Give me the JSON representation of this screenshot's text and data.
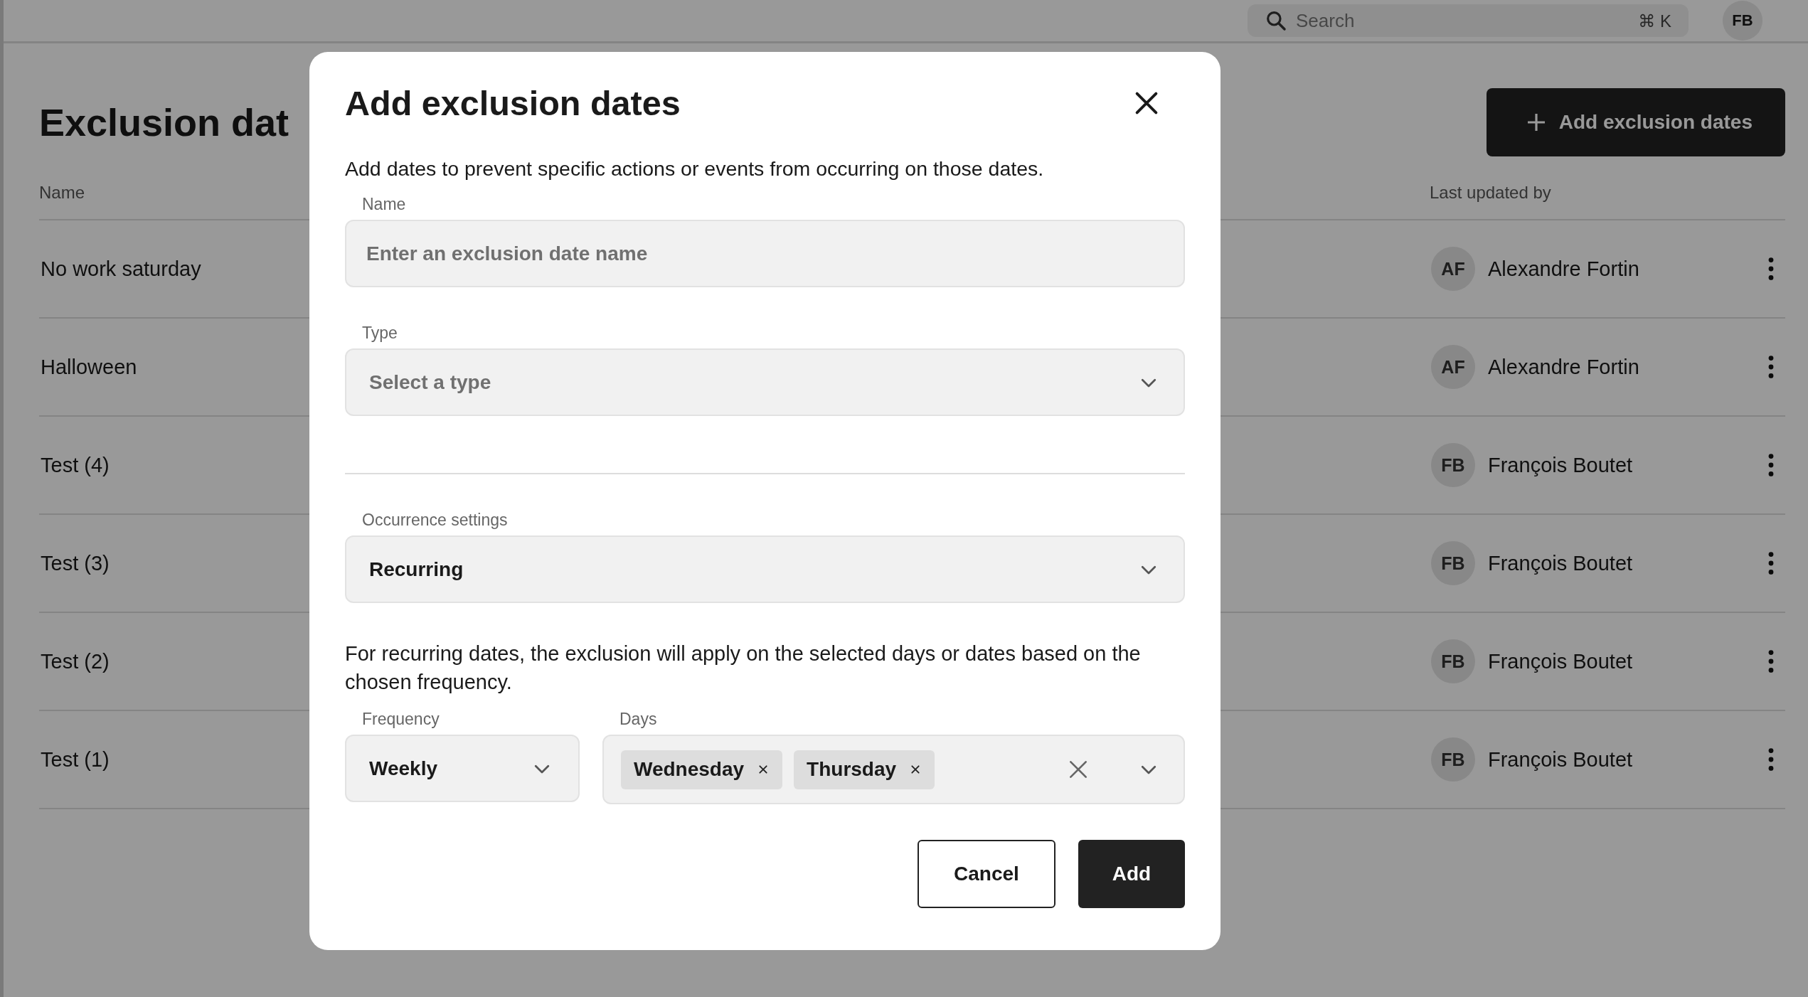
{
  "top_bar": {
    "search": {
      "placeholder": "Search",
      "shortcut": "⌘ K"
    },
    "avatar": "FB"
  },
  "page": {
    "title": "Exclusion dat",
    "add_button": "Add exclusion dates"
  },
  "table": {
    "columns": [
      "Name",
      "Last updated by"
    ],
    "rows": [
      {
        "name": "No work saturday",
        "initials": "AF",
        "user": "Alexandre Fortin"
      },
      {
        "name": "Halloween",
        "initials": "AF",
        "user": "Alexandre Fortin"
      },
      {
        "name": "Test (4)",
        "initials": "FB",
        "user": "François Boutet"
      },
      {
        "name": "Test (3)",
        "initials": "FB",
        "user": "François Boutet"
      },
      {
        "name": "Test (2)",
        "initials": "FB",
        "user": "François Boutet"
      },
      {
        "name": "Test (1)",
        "initials": "FB",
        "user": "François Boutet"
      }
    ]
  },
  "dialog": {
    "title": "Add exclusion dates",
    "description": "Add dates to prevent specific actions or events from occurring on those dates.",
    "name_field": {
      "label": "Name",
      "placeholder": "Enter an exclusion date name"
    },
    "type_field": {
      "label": "Type",
      "placeholder": "Select a type"
    },
    "occurrence_field": {
      "label": "Occurrence settings",
      "value": "Recurring"
    },
    "recurring_note": "For recurring dates, the exclusion will apply on the selected days or dates based on the chosen frequency.",
    "frequency_field": {
      "label": "Frequency",
      "value": "Weekly"
    },
    "days_field": {
      "label": "Days",
      "tags": [
        "Wednesday",
        "Thursday"
      ]
    },
    "buttons": [
      {
        "label": "Cancel",
        "kind": "secondary"
      },
      {
        "label": "Add",
        "kind": "primary"
      }
    ]
  }
}
